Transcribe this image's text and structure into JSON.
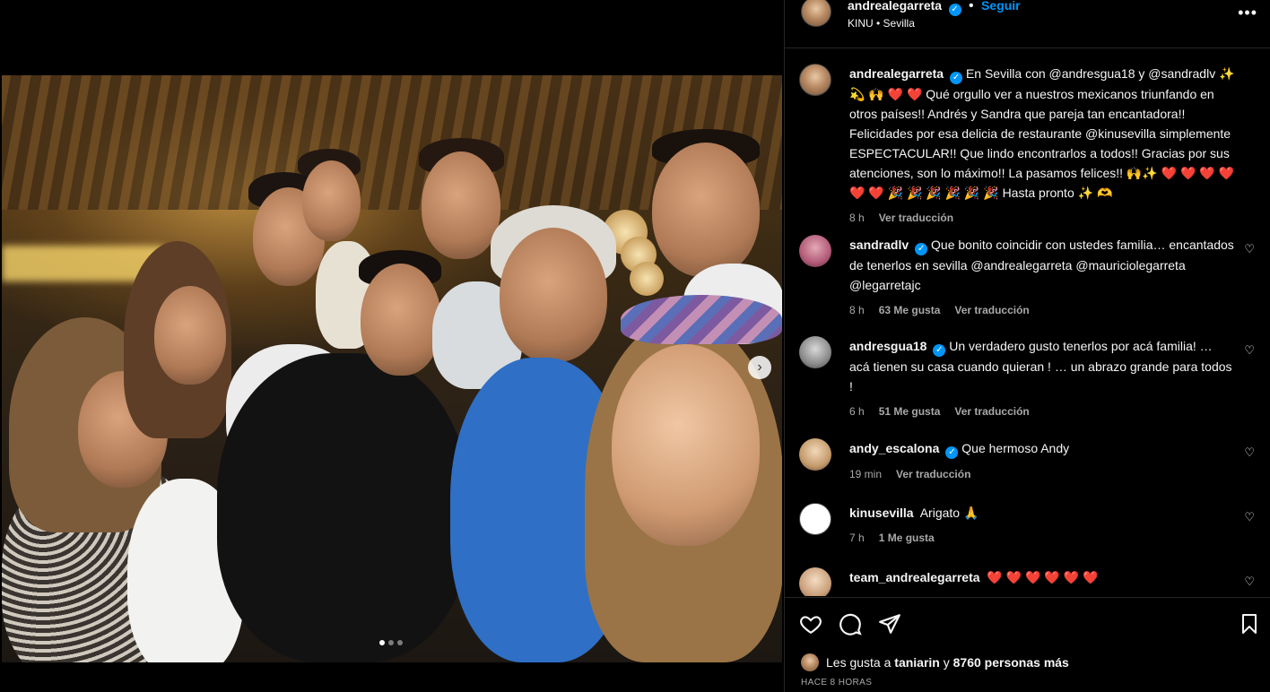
{
  "post": {
    "author": "andrealegarreta",
    "follow_label": "Seguir",
    "location": "KINU • Sevilla",
    "more_label": "•••",
    "caption": "En Sevilla con @andresgua18 y @sandradlv ✨ 💫 🙌 ❤️ ❤️ Qué orgullo ver a nuestros mexicanos triunfando en otros países!! Andrés y Sandra que pareja tan encantadora!! Felicidades por esa delicia de restaurante @kinusevilla simplemente ESPECTACULAR!! Que lindo encontrarlos a todos!! Gracias por sus atenciones, son lo máximo!! La pasamos felices!! 🙌✨ ❤️ ❤️ ❤️ ❤️ ❤️ ❤️ 🎉 🎉 🎉 🎉 🎉 🎉 Hasta pronto ✨ 🫶",
    "caption_time": "8 h",
    "caption_translate": "Ver traducción"
  },
  "comments": [
    {
      "user": "sandradlv",
      "text": "Que bonito coincidir con ustedes familia… encantados de tenerlos en sevilla @andrealegarreta @mauriciolegarreta @legarretajc",
      "time": "8 h",
      "likes": "63 Me gusta",
      "translate": "Ver traducción"
    },
    {
      "user": "andresgua18",
      "text": "Un verdadero gusto tenerlos por acá familia! … acá tienen su casa cuando quieran ! … un abrazo grande para todos !",
      "time": "6 h",
      "likes": "51 Me gusta",
      "translate": "Ver traducción"
    },
    {
      "user": "andy_escalona",
      "text": "Que hermoso Andy",
      "time": "19 min",
      "translate": "Ver traducción"
    },
    {
      "user": "kinusevilla",
      "text": "Arigato 🙏",
      "time": "7 h",
      "likes": "1 Me gusta"
    },
    {
      "user": "team_andrealegarreta",
      "text": "❤️ ❤️ ❤️ ❤️ ❤️ ❤️"
    }
  ],
  "footer": {
    "likes_prefix": "Les gusta a",
    "likes_user": "taniarin",
    "likes_mid": "y",
    "likes_count": "8760 personas más",
    "posted": "HACE 8 HORAS"
  },
  "carousel": {
    "next_label": "›",
    "total": 3,
    "active": 1
  },
  "colors": {
    "accent": "#0095f6",
    "like": "#ff3040"
  },
  "icons": [
    "heart-icon",
    "comment-icon",
    "share-icon",
    "bookmark-icon",
    "verified-icon"
  ]
}
